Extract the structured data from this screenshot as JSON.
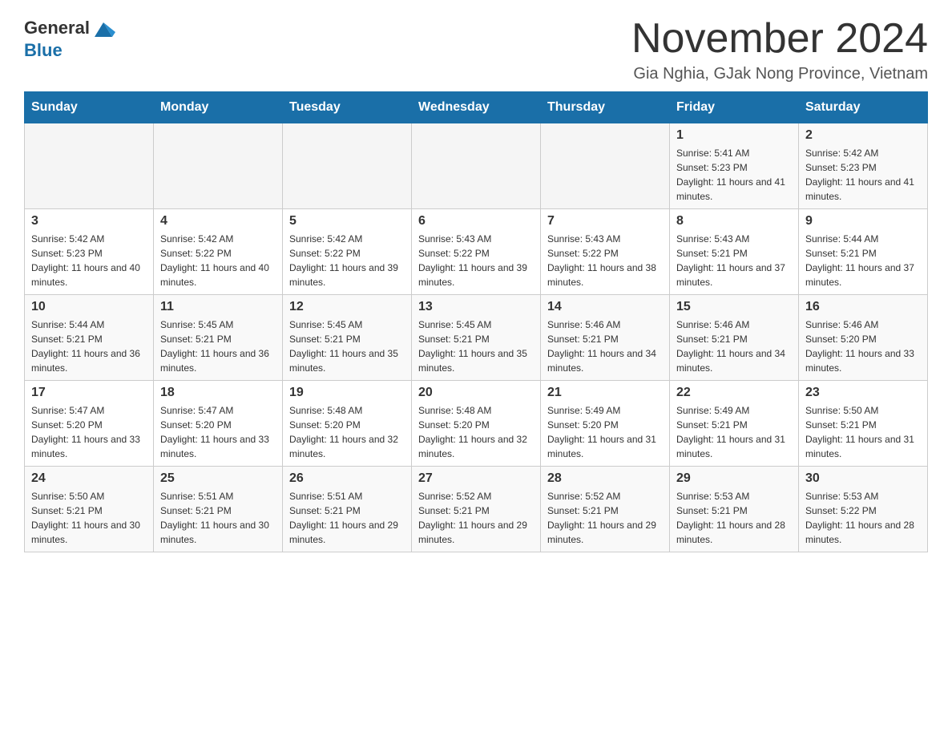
{
  "header": {
    "logo": {
      "text_general": "General",
      "text_blue": "Blue"
    },
    "title": "November 2024",
    "location": "Gia Nghia, GJak Nong Province, Vietnam"
  },
  "calendar": {
    "days_of_week": [
      "Sunday",
      "Monday",
      "Tuesday",
      "Wednesday",
      "Thursday",
      "Friday",
      "Saturday"
    ],
    "weeks": [
      {
        "days": [
          {
            "date": "",
            "info": ""
          },
          {
            "date": "",
            "info": ""
          },
          {
            "date": "",
            "info": ""
          },
          {
            "date": "",
            "info": ""
          },
          {
            "date": "",
            "info": ""
          },
          {
            "date": "1",
            "info": "Sunrise: 5:41 AM\nSunset: 5:23 PM\nDaylight: 11 hours and 41 minutes."
          },
          {
            "date": "2",
            "info": "Sunrise: 5:42 AM\nSunset: 5:23 PM\nDaylight: 11 hours and 41 minutes."
          }
        ]
      },
      {
        "days": [
          {
            "date": "3",
            "info": "Sunrise: 5:42 AM\nSunset: 5:23 PM\nDaylight: 11 hours and 40 minutes."
          },
          {
            "date": "4",
            "info": "Sunrise: 5:42 AM\nSunset: 5:22 PM\nDaylight: 11 hours and 40 minutes."
          },
          {
            "date": "5",
            "info": "Sunrise: 5:42 AM\nSunset: 5:22 PM\nDaylight: 11 hours and 39 minutes."
          },
          {
            "date": "6",
            "info": "Sunrise: 5:43 AM\nSunset: 5:22 PM\nDaylight: 11 hours and 39 minutes."
          },
          {
            "date": "7",
            "info": "Sunrise: 5:43 AM\nSunset: 5:22 PM\nDaylight: 11 hours and 38 minutes."
          },
          {
            "date": "8",
            "info": "Sunrise: 5:43 AM\nSunset: 5:21 PM\nDaylight: 11 hours and 37 minutes."
          },
          {
            "date": "9",
            "info": "Sunrise: 5:44 AM\nSunset: 5:21 PM\nDaylight: 11 hours and 37 minutes."
          }
        ]
      },
      {
        "days": [
          {
            "date": "10",
            "info": "Sunrise: 5:44 AM\nSunset: 5:21 PM\nDaylight: 11 hours and 36 minutes."
          },
          {
            "date": "11",
            "info": "Sunrise: 5:45 AM\nSunset: 5:21 PM\nDaylight: 11 hours and 36 minutes."
          },
          {
            "date": "12",
            "info": "Sunrise: 5:45 AM\nSunset: 5:21 PM\nDaylight: 11 hours and 35 minutes."
          },
          {
            "date": "13",
            "info": "Sunrise: 5:45 AM\nSunset: 5:21 PM\nDaylight: 11 hours and 35 minutes."
          },
          {
            "date": "14",
            "info": "Sunrise: 5:46 AM\nSunset: 5:21 PM\nDaylight: 11 hours and 34 minutes."
          },
          {
            "date": "15",
            "info": "Sunrise: 5:46 AM\nSunset: 5:21 PM\nDaylight: 11 hours and 34 minutes."
          },
          {
            "date": "16",
            "info": "Sunrise: 5:46 AM\nSunset: 5:20 PM\nDaylight: 11 hours and 33 minutes."
          }
        ]
      },
      {
        "days": [
          {
            "date": "17",
            "info": "Sunrise: 5:47 AM\nSunset: 5:20 PM\nDaylight: 11 hours and 33 minutes."
          },
          {
            "date": "18",
            "info": "Sunrise: 5:47 AM\nSunset: 5:20 PM\nDaylight: 11 hours and 33 minutes."
          },
          {
            "date": "19",
            "info": "Sunrise: 5:48 AM\nSunset: 5:20 PM\nDaylight: 11 hours and 32 minutes."
          },
          {
            "date": "20",
            "info": "Sunrise: 5:48 AM\nSunset: 5:20 PM\nDaylight: 11 hours and 32 minutes."
          },
          {
            "date": "21",
            "info": "Sunrise: 5:49 AM\nSunset: 5:20 PM\nDaylight: 11 hours and 31 minutes."
          },
          {
            "date": "22",
            "info": "Sunrise: 5:49 AM\nSunset: 5:21 PM\nDaylight: 11 hours and 31 minutes."
          },
          {
            "date": "23",
            "info": "Sunrise: 5:50 AM\nSunset: 5:21 PM\nDaylight: 11 hours and 31 minutes."
          }
        ]
      },
      {
        "days": [
          {
            "date": "24",
            "info": "Sunrise: 5:50 AM\nSunset: 5:21 PM\nDaylight: 11 hours and 30 minutes."
          },
          {
            "date": "25",
            "info": "Sunrise: 5:51 AM\nSunset: 5:21 PM\nDaylight: 11 hours and 30 minutes."
          },
          {
            "date": "26",
            "info": "Sunrise: 5:51 AM\nSunset: 5:21 PM\nDaylight: 11 hours and 29 minutes."
          },
          {
            "date": "27",
            "info": "Sunrise: 5:52 AM\nSunset: 5:21 PM\nDaylight: 11 hours and 29 minutes."
          },
          {
            "date": "28",
            "info": "Sunrise: 5:52 AM\nSunset: 5:21 PM\nDaylight: 11 hours and 29 minutes."
          },
          {
            "date": "29",
            "info": "Sunrise: 5:53 AM\nSunset: 5:21 PM\nDaylight: 11 hours and 28 minutes."
          },
          {
            "date": "30",
            "info": "Sunrise: 5:53 AM\nSunset: 5:22 PM\nDaylight: 11 hours and 28 minutes."
          }
        ]
      }
    ]
  }
}
